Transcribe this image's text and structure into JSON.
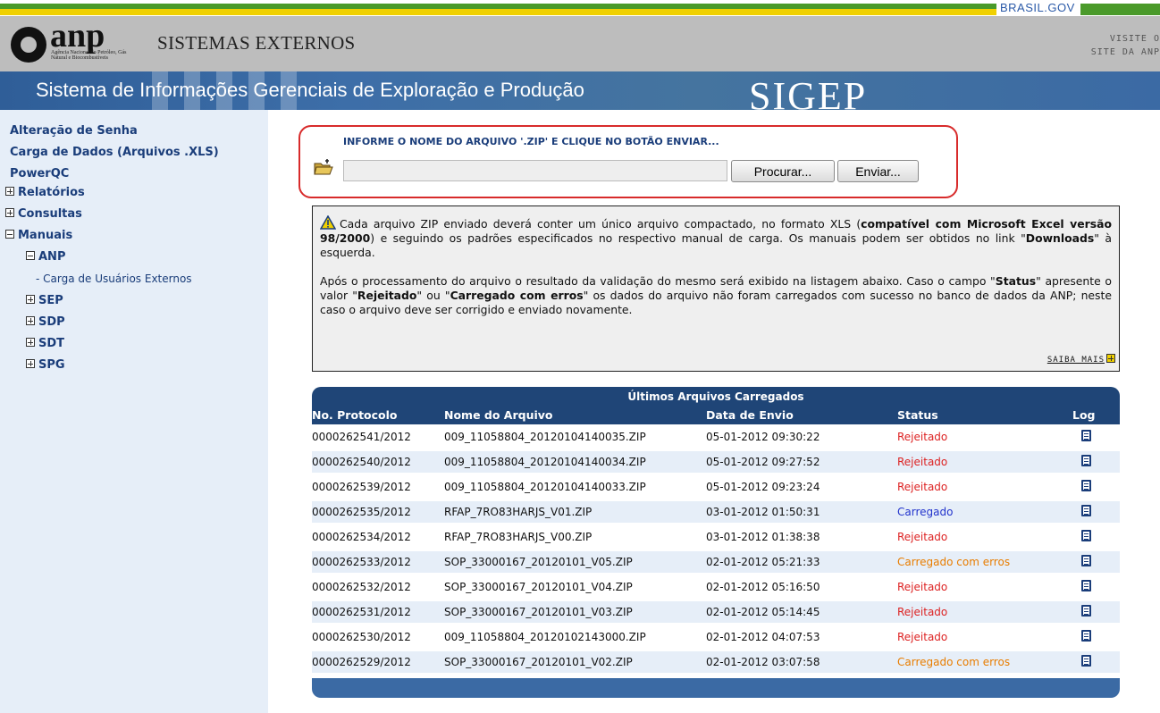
{
  "govbar": {
    "label": "BRASIL.GOV"
  },
  "header": {
    "logo_text": "anp",
    "logo_subtext": "Agência Nacional do Petróleo, Gás Natural e Biocombustíveis",
    "system_title": "SISTEMAS EXTERNOS",
    "visit_line1": "VISITE O",
    "visit_line2": "SITE DA ANP"
  },
  "banner": {
    "title": "Sistema de Informações Gerenciais de Exploração e Produção",
    "acronym": "SIGEP"
  },
  "sidebar": {
    "items": [
      {
        "label": "Alteração de Senha"
      },
      {
        "label": "Carga de Dados (Arquivos .XLS)"
      },
      {
        "label": "PowerQC"
      },
      {
        "label": "Relatórios"
      },
      {
        "label": "Consultas"
      },
      {
        "label": "Manuais"
      },
      {
        "label": "ANP"
      },
      {
        "label": "- Carga de Usuários Externos"
      },
      {
        "label": "SEP"
      },
      {
        "label": "SDP"
      },
      {
        "label": "SDT"
      },
      {
        "label": "SPG"
      }
    ]
  },
  "upload": {
    "instruction": "INFORME O NOME DO ARQUIVO '.ZIP' E CLIQUE NO BOTÃO ENVIAR...",
    "file_value": "",
    "browse_label": "Procurar...",
    "send_label": "Enviar..."
  },
  "info": {
    "p1_a": "Cada arquivo ZIP enviado deverá conter um único arquivo compactado, no formato XLS (",
    "p1_b": "compatível com Microsoft Excel versão 98/2000",
    "p1_c": ") e seguindo os padrões especificados no respectivo manual de carga. Os manuais podem ser obtidos no link \"",
    "p1_d": "Downloads",
    "p1_e": "\" à esquerda.",
    "p2_a": "Após o processamento do arquivo o resultado da validação do mesmo será exibido na listagem abaixo. Caso o campo \"",
    "p2_b": "Status",
    "p2_c": "\" apresente o valor \"",
    "p2_d": "Rejeitado",
    "p2_e": "\" ou \"",
    "p2_f": "Carregado com erros",
    "p2_g": "\" os dados do arquivo não foram carregados com sucesso no banco de dados da ANP; neste caso o arquivo deve ser corrigido e enviado novamente.",
    "saiba_mais": "SAIBA MAIS"
  },
  "table": {
    "caption": "Últimos Arquivos Carregados",
    "headers": {
      "protocol": "No. Protocolo",
      "filename": "Nome do Arquivo",
      "date": "Data de Envio",
      "status": "Status",
      "log": "Log"
    },
    "rows": [
      {
        "protocol": "0000262541/2012",
        "filename": "009_11058804_20120104140035.ZIP",
        "date": "05-01-2012 09:30:22",
        "status": "Rejeitado"
      },
      {
        "protocol": "0000262540/2012",
        "filename": "009_11058804_20120104140034.ZIP",
        "date": "05-01-2012 09:27:52",
        "status": "Rejeitado"
      },
      {
        "protocol": "0000262539/2012",
        "filename": "009_11058804_20120104140033.ZIP",
        "date": "05-01-2012 09:23:24",
        "status": "Rejeitado"
      },
      {
        "protocol": "0000262535/2012",
        "filename": "RFAP_7RO83HARJS_V01.ZIP",
        "date": "03-01-2012 01:50:31",
        "status": "Carregado"
      },
      {
        "protocol": "0000262534/2012",
        "filename": "RFAP_7RO83HARJS_V00.ZIP",
        "date": "03-01-2012 01:38:38",
        "status": "Rejeitado"
      },
      {
        "protocol": "0000262533/2012",
        "filename": "SOP_33000167_20120101_V05.ZIP",
        "date": "02-01-2012 05:21:33",
        "status": "Carregado com erros"
      },
      {
        "protocol": "0000262532/2012",
        "filename": "SOP_33000167_20120101_V04.ZIP",
        "date": "02-01-2012 05:16:50",
        "status": "Rejeitado"
      },
      {
        "protocol": "0000262531/2012",
        "filename": "SOP_33000167_20120101_V03.ZIP",
        "date": "02-01-2012 05:14:45",
        "status": "Rejeitado"
      },
      {
        "protocol": "0000262530/2012",
        "filename": "009_11058804_20120102143000.ZIP",
        "date": "02-01-2012 04:07:53",
        "status": "Rejeitado"
      },
      {
        "protocol": "0000262529/2012",
        "filename": "SOP_33000167_20120101_V02.ZIP",
        "date": "02-01-2012 03:07:58",
        "status": "Carregado com erros"
      }
    ]
  },
  "colors": {
    "nav_text": "#1a3d7a",
    "banner": "#3a6aa6",
    "status_rejected": "#dd2222",
    "status_loaded": "#2233cc",
    "status_errors": "#e87d00",
    "upload_border": "#d82b2b"
  }
}
